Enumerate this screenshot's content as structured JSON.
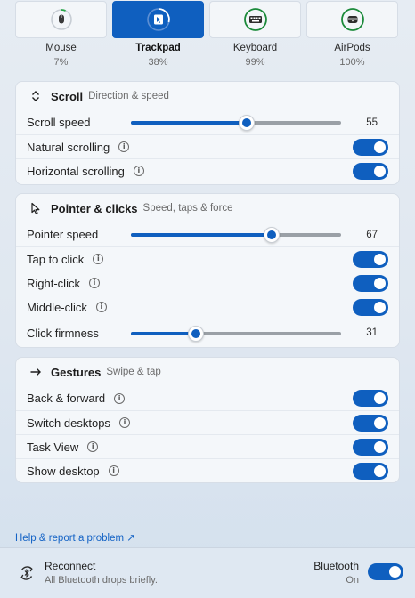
{
  "devices": [
    {
      "name": "Mouse",
      "pct": "7%",
      "icon": "mouse-icon",
      "active": false
    },
    {
      "name": "Trackpad",
      "pct": "38%",
      "icon": "trackpad-icon",
      "active": true
    },
    {
      "name": "Keyboard",
      "pct": "99%",
      "icon": "keyboard-icon",
      "active": false
    },
    {
      "name": "AirPods",
      "pct": "100%",
      "icon": "airpods-icon",
      "active": false
    }
  ],
  "scroll": {
    "title": "Scroll",
    "subtitle": "Direction & speed",
    "speed_label": "Scroll speed",
    "speed_value": "55",
    "natural_label": "Natural scrolling",
    "natural_on": true,
    "horizontal_label": "Horizontal scrolling",
    "horizontal_on": true
  },
  "pointer": {
    "title": "Pointer & clicks",
    "subtitle": "Speed, taps & force",
    "speed_label": "Pointer speed",
    "speed_value": "67",
    "tap_label": "Tap to click",
    "tap_on": true,
    "right_label": "Right-click",
    "right_on": true,
    "middle_label": "Middle-click",
    "middle_on": true,
    "firmness_label": "Click firmness",
    "firmness_value": "31"
  },
  "gestures": {
    "title": "Gestures",
    "subtitle": "Swipe & tap",
    "items": [
      {
        "label": "Back & forward",
        "on": true
      },
      {
        "label": "Switch desktops",
        "on": true
      },
      {
        "label": "Task View",
        "on": true
      },
      {
        "label": "Show desktop",
        "on": true
      }
    ]
  },
  "help_link": "Help & report a problem ↗",
  "footer": {
    "reconnect_title": "Reconnect",
    "reconnect_sub": "All Bluetooth drops briefly.",
    "bluetooth_title": "Bluetooth",
    "bluetooth_state": "On",
    "bluetooth_on": true
  },
  "colors": {
    "accent": "#0f5fbf",
    "battery_ring": "#1b8a3a",
    "battery_low": "#2aa84a"
  }
}
